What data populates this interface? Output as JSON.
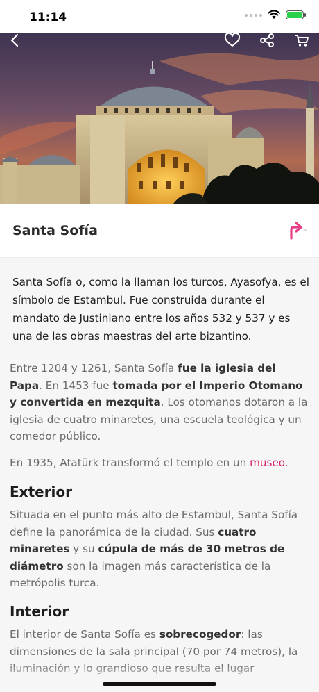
{
  "status_bar": {
    "time": "11:14",
    "icons": [
      "signal-dots-icon",
      "wifi-icon",
      "battery-charging-icon"
    ],
    "battery_color": "#2bd14a"
  },
  "toolbar": {
    "icons": [
      "back-chevron-icon",
      "heart-icon",
      "share-icon",
      "cart-icon"
    ]
  },
  "place": {
    "title": "Santa Sofía",
    "directions_icon": "turn-right-arrow-icon",
    "accent_color": "#e83e86"
  },
  "article": {
    "intro": "Santa Sofía o, como la llaman los turcos, Ayasofya, es el símbolo de Estambul. Fue construida durante el mandato de Justiniano entre los años 532 y 537 y es una de las obras maestras del arte bizantino.",
    "p1": {
      "t1": "Entre 1204 y 1261, Santa Sofía ",
      "b1": "fue la iglesia del Papa",
      "t2": ". En 1453 fue ",
      "b2": "tomada por el Imperio Otomano y convertida en mezquita",
      "t3": ". Los otomanos dotaron a la iglesia de cuatro minaretes, una escuela teológica y un comedor público."
    },
    "p2": {
      "t1": "En 1935, Atatürk transformó el templo en un ",
      "link": "museo",
      "t2": "."
    },
    "section_exterior": {
      "heading": "Exterior",
      "t1": "Situada en el punto más alto de Estambul, Santa Sofía define la panorámica de la ciudad. Sus ",
      "b1": "cuatro minaretes",
      "t2": " y su ",
      "b2": "cúpula de más de 30 metros de diámetro",
      "t3": " son la imagen más característica de la metrópolis turca."
    },
    "section_interior": {
      "heading": "Interior",
      "t1": "El interior de Santa Sofía es ",
      "b1": "sobrecogedor",
      "t2": ": las dimensiones de la sala principal (70 por 74 metros), la iluminación y lo grandioso que resulta el lugar"
    },
    "link_color": "#d6246e"
  }
}
